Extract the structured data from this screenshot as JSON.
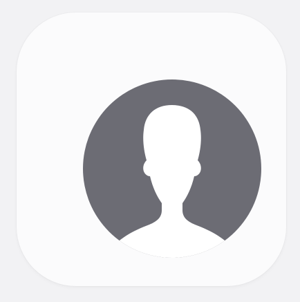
{
  "app_icon": {
    "name": "contacts-app-icon",
    "icon": "default-avatar-icon",
    "background_color": "#fbfbfc",
    "avatar_color": "#6c6c74",
    "silhouette_color": "#ffffff"
  }
}
